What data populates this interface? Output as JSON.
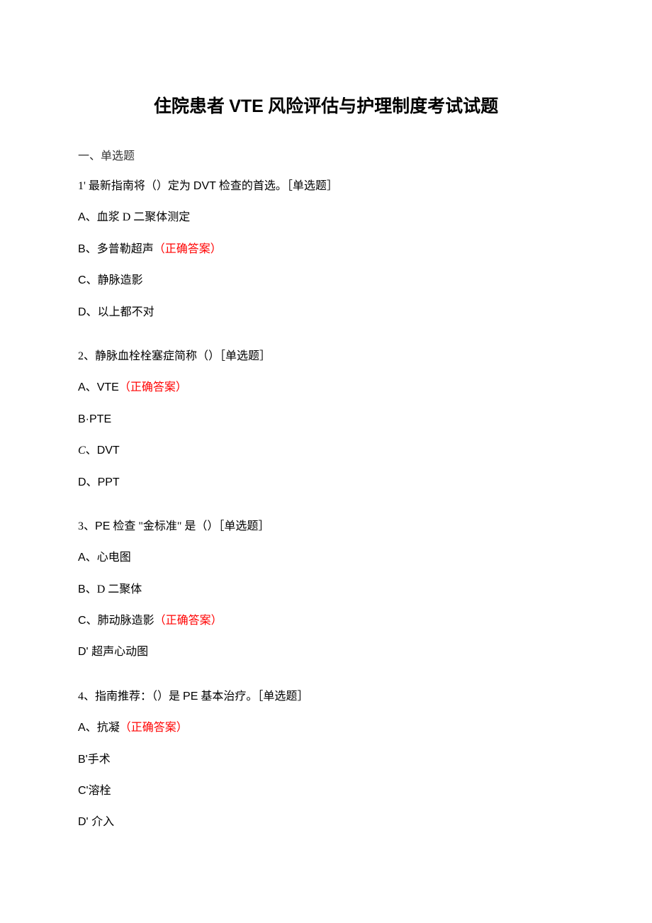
{
  "title_pre": "住院患者 ",
  "title_vte": "VTE",
  "title_post": " 风险评估与护理制度考试试题",
  "section1": "一、单选题",
  "q1": {
    "stem_pre": "1' 最新指南将（）定为 ",
    "stem_dvt": "DVT",
    "stem_post": " 检查的首选。［单选题］",
    "a_label": "A、",
    "a_text": "血浆 D 二聚体测定",
    "b_label": "B、",
    "b_text": "多普勒超声",
    "b_correct": "（正确答案）",
    "c_label": "C、",
    "c_text": "静脉造影",
    "d_label": "D、",
    "d_text": "以上都不对"
  },
  "q2": {
    "stem": "2、静脉血栓栓塞症简称（）［单选题］",
    "a_label": "A、",
    "a_text": "VTE",
    "a_correct": "（正确答案）",
    "b_text": "B·PTE",
    "c_label": "C",
    "c_sep": "、",
    "c_text": "DVT",
    "d_label": "D、",
    "d_text": "PPT"
  },
  "q3": {
    "stem_pre": "3、",
    "stem_pe": "PE",
    "stem_post": " 检查 \"金标准\" 是（）［单选题］",
    "a_label": "A、",
    "a_text": "心电图",
    "b_label": "B、",
    "b_text": "D 二聚体",
    "c_label": "C、",
    "c_text": "肺动脉造影",
    "c_correct": "（正确答案）",
    "d_label": "D' ",
    "d_text": "超声心动图"
  },
  "q4": {
    "stem_pre": "4、指南推荐：（）是 ",
    "stem_pe": "PE",
    "stem_post": " 基本治疗。［单选题］",
    "a_label": "A、",
    "a_text": "抗凝",
    "a_correct": "（正确答案）",
    "b_text": "B'手术",
    "c_text": "C'溶栓",
    "d_label": "D' ",
    "d_text": "介入"
  }
}
